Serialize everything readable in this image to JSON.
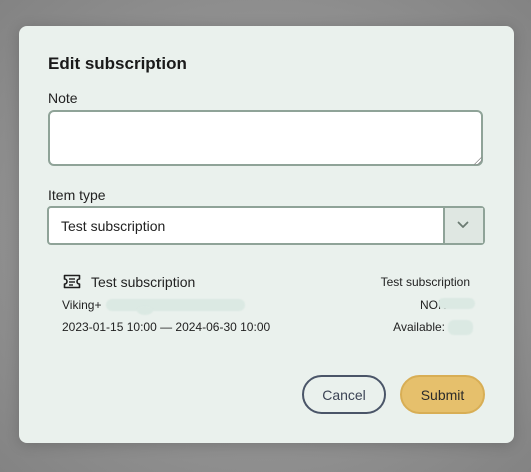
{
  "dialog": {
    "title": "Edit subscription",
    "note": {
      "label": "Note",
      "value": "",
      "placeholder": ""
    },
    "item_type": {
      "label": "Item type",
      "selected": "Test subscription"
    },
    "subscription": {
      "icon": "ticket-icon",
      "name": "Test subscription",
      "provider": "Viking+",
      "dates": "2023-01-15 10:00 — 2024-06-30 10:00",
      "right_name": "Test subscription",
      "currency": "NOK",
      "available_label": "Available:"
    },
    "buttons": {
      "cancel": "Cancel",
      "submit": "Submit"
    }
  },
  "colors": {
    "backdrop": "#8f8f8f",
    "dialog_bg": "#eaf1ed",
    "input_border": "#8fa398",
    "submit_bg": "#e6c06c",
    "cancel_border": "#4a5568"
  }
}
